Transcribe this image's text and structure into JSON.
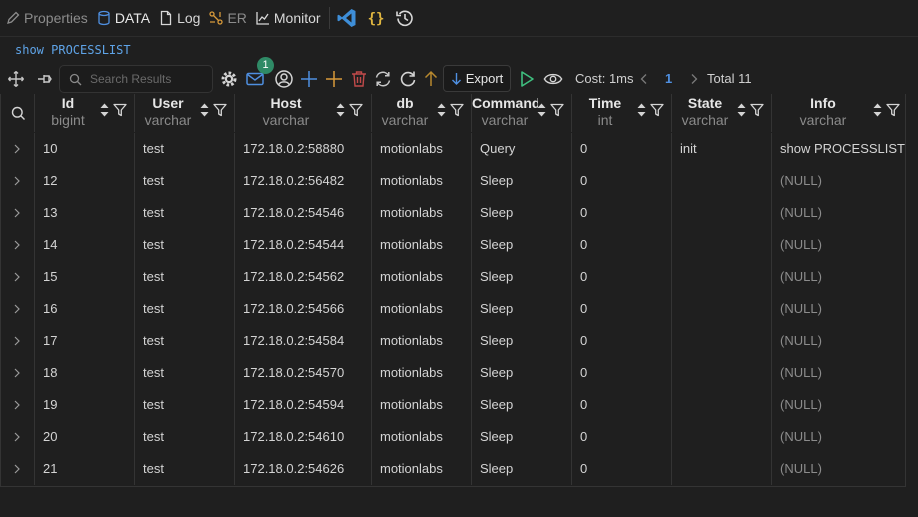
{
  "tabs": [
    {
      "label": "Properties",
      "icon": "pencil-icon"
    },
    {
      "label": "DATA",
      "icon": "database-icon"
    },
    {
      "label": "Log",
      "icon": "document-icon"
    },
    {
      "label": "ER",
      "icon": "er-diagram-icon"
    },
    {
      "label": "Monitor",
      "icon": "chart-icon"
    }
  ],
  "query": "show PROCESSLIST",
  "toolbar": {
    "search_placeholder": "Search Results",
    "notification_count": "1",
    "export_label": "Export",
    "cost": "Cost: 1ms",
    "page": "1",
    "total": "Total 11"
  },
  "columns": [
    {
      "name": "Id",
      "type": "bigint"
    },
    {
      "name": "User",
      "type": "varchar"
    },
    {
      "name": "Host",
      "type": "varchar"
    },
    {
      "name": "db",
      "type": "varchar"
    },
    {
      "name": "Command",
      "type": "varchar"
    },
    {
      "name": "Time",
      "type": "int"
    },
    {
      "name": "State",
      "type": "varchar"
    },
    {
      "name": "Info",
      "type": "varchar"
    }
  ],
  "rows": [
    [
      "10",
      "test",
      "172.18.0.2:58880",
      "motionlabs",
      "Query",
      "0",
      "init",
      "show PROCESSLIST"
    ],
    [
      "12",
      "test",
      "172.18.0.2:56482",
      "motionlabs",
      "Sleep",
      "0",
      "",
      "(NULL)"
    ],
    [
      "13",
      "test",
      "172.18.0.2:54546",
      "motionlabs",
      "Sleep",
      "0",
      "",
      "(NULL)"
    ],
    [
      "14",
      "test",
      "172.18.0.2:54544",
      "motionlabs",
      "Sleep",
      "0",
      "",
      "(NULL)"
    ],
    [
      "15",
      "test",
      "172.18.0.2:54562",
      "motionlabs",
      "Sleep",
      "0",
      "",
      "(NULL)"
    ],
    [
      "16",
      "test",
      "172.18.0.2:54566",
      "motionlabs",
      "Sleep",
      "0",
      "",
      "(NULL)"
    ],
    [
      "17",
      "test",
      "172.18.0.2:54584",
      "motionlabs",
      "Sleep",
      "0",
      "",
      "(NULL)"
    ],
    [
      "18",
      "test",
      "172.18.0.2:54570",
      "motionlabs",
      "Sleep",
      "0",
      "",
      "(NULL)"
    ],
    [
      "19",
      "test",
      "172.18.0.2:54594",
      "motionlabs",
      "Sleep",
      "0",
      "",
      "(NULL)"
    ],
    [
      "20",
      "test",
      "172.18.0.2:54610",
      "motionlabs",
      "Sleep",
      "0",
      "",
      "(NULL)"
    ],
    [
      "21",
      "test",
      "172.18.0.2:54626",
      "motionlabs",
      "Sleep",
      "0",
      "",
      "(NULL)"
    ]
  ],
  "colors": {
    "accent_blue": "#4f8fe0",
    "badge_green": "#2f8a66",
    "run_green": "#3fbf7f",
    "plus_blue": "#4f8fe0",
    "plus_orange": "#d89a3a",
    "delete_red": "#c14a4a",
    "query_text": "#5fa4e8"
  }
}
